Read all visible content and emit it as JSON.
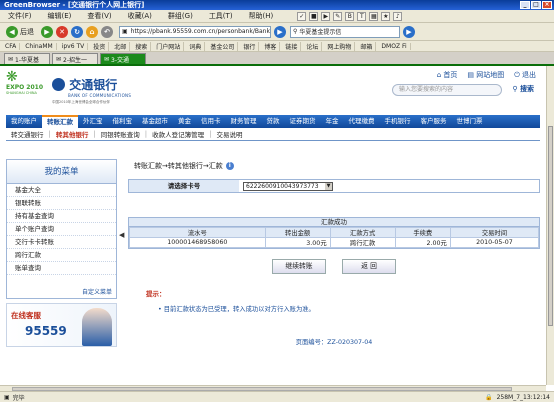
{
  "window": {
    "title": "GreenBrowser - [交通银行个人网上银行]",
    "buttons": [
      "_",
      "□",
      "×"
    ]
  },
  "menu": [
    "文件(F)",
    "编辑(E)",
    "查看(V)",
    "收藏(A)",
    "群组(G)",
    "工具(T)",
    "帮助(H)"
  ],
  "toolbar": {
    "back": "后退",
    "address": "https://pbank.95559.com.cn/personbank/Bank",
    "search_engine": "华夏基金提示信"
  },
  "favorites": [
    "CFA",
    "ChinaMM",
    "ipv6 TV",
    "投资",
    "北邮",
    "搜索",
    "门户网站",
    "词典",
    "基金公司",
    "银行",
    "博客",
    "链接",
    "论坛",
    "网上购物",
    "邮箱",
    "DMOZ Fi"
  ],
  "tabs": [
    "1-华夏基",
    "2-招生一",
    "3-交通"
  ],
  "bank": {
    "logo_cn": "交通银行",
    "logo_en": "BANK OF COMMUNICATIONS",
    "logo_sub": "中国2010年上海世博会全球合作伙伴",
    "expo": "EXPO 2010",
    "expo_sub": "SHANGHAI CHINA",
    "toplinks": [
      "首页",
      "网站地图",
      "退出"
    ],
    "search_placeholder": "输入您要搜索的内容",
    "search_button": "搜索",
    "main_nav": [
      "我的账户",
      "转账汇款",
      "外汇宝",
      "借利宝",
      "基金超市",
      "黄金",
      "信用卡",
      "财务管理",
      "贷款",
      "证券期货",
      "年金",
      "代理缴费",
      "手机银行",
      "客户服务",
      "世博门票"
    ],
    "main_nav_active": 1,
    "sub_nav": [
      "转交通银行",
      "转其他银行",
      "同银转账查询",
      "收款人登记簿管理",
      "交易说明"
    ],
    "sub_nav_active": 1,
    "left_menu": {
      "title": "我的菜单",
      "items": [
        "基金大全",
        "银联转账",
        "持有基金查询",
        "单个账户查询",
        "交行卡卡转账",
        "跨行汇款",
        "账单查询"
      ],
      "custom": "自定义菜单"
    },
    "hotline": {
      "label": "在线客服",
      "number": "95559"
    }
  },
  "content": {
    "breadcrumb": "转账汇款→转其他银行→汇款",
    "card_label": "请选择卡号",
    "card_value": "6222600910043973773",
    "result_caption": "汇款成功",
    "columns": [
      "流水号",
      "转出金额",
      "汇款方式",
      "手续费",
      "交易时间"
    ],
    "rows": [
      [
        "100001468958060",
        "3.00元",
        "跨行汇款",
        "2.00元",
        "2010-05-07"
      ]
    ],
    "buttons": [
      "继续转账",
      "返 回"
    ],
    "tips_title": "提示：",
    "tips_message": "目前汇款状态为已受理，转入成功以对方行入账为准。",
    "page_number": "页面编号：ZZ-020307-04"
  },
  "status": {
    "left": "完毕",
    "right": "258M_7_13:12:14"
  }
}
